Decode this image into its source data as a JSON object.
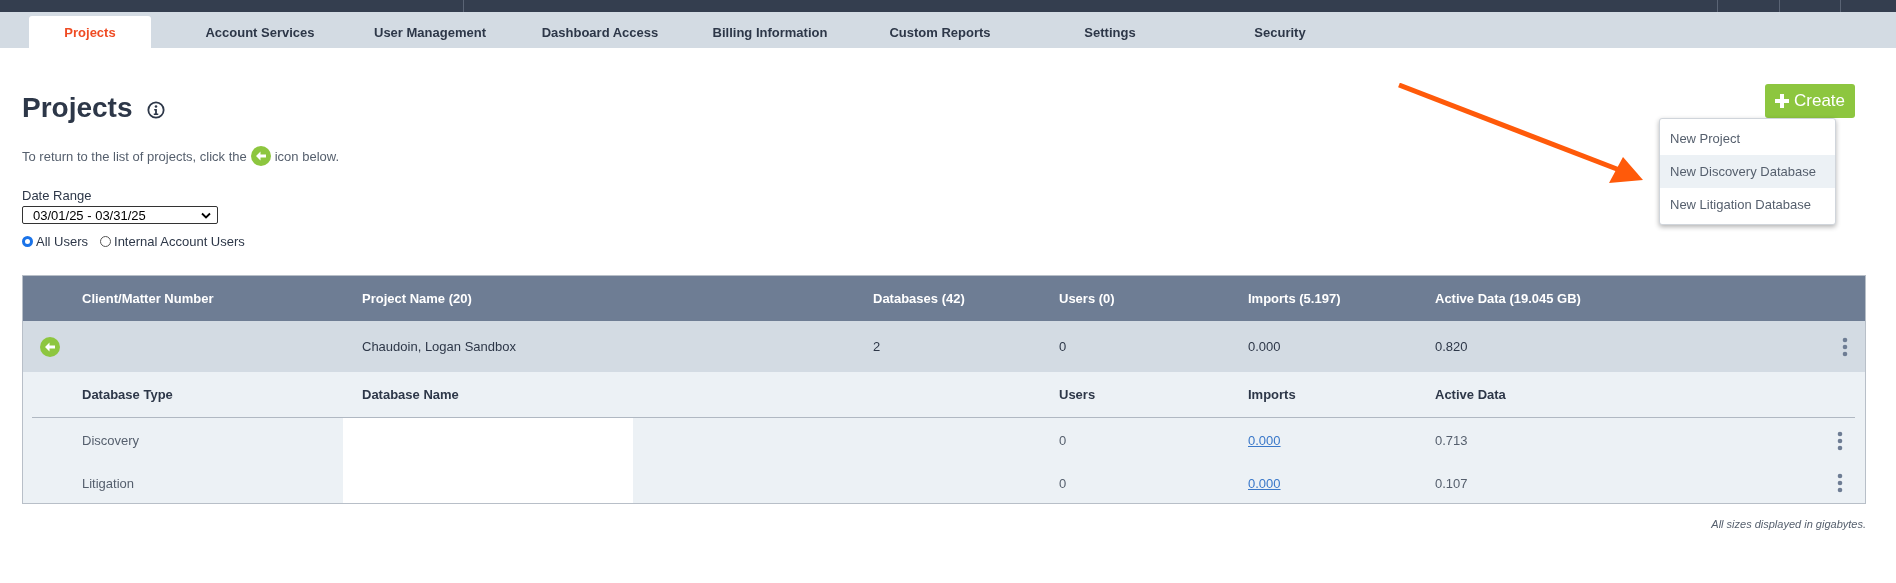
{
  "tabs": [
    {
      "label": "Projects",
      "selected": true
    },
    {
      "label": "Account Services",
      "selected": false
    },
    {
      "label": "User Management",
      "selected": false
    },
    {
      "label": "Dashboard Access",
      "selected": false
    },
    {
      "label": "Billing Information",
      "selected": false
    },
    {
      "label": "Custom Reports",
      "selected": false
    },
    {
      "label": "Settings",
      "selected": false
    },
    {
      "label": "Security",
      "selected": false
    }
  ],
  "title": "Projects",
  "instruction": {
    "before": "To return to the list of projects, click the",
    "after": "icon below."
  },
  "date_range": {
    "label": "Date Range",
    "value": "03/01/25 - 03/31/25"
  },
  "user_filter": [
    {
      "label": "All Users",
      "selected": true
    },
    {
      "label": "Internal Account Users",
      "selected": false
    }
  ],
  "create_button": {
    "label": "Create"
  },
  "create_menu": [
    {
      "label": "New Project",
      "highlighted": false
    },
    {
      "label": "New Discovery Database",
      "highlighted": true
    },
    {
      "label": "New Litigation Database",
      "highlighted": false
    }
  ],
  "table": {
    "columns": [
      "Client/Matter Number",
      "Project Name (20)",
      "Databases (42)",
      "Users (0)",
      "Imports (5.197)",
      "Active Data (19.045 GB)"
    ],
    "project": {
      "name": "Chaudoin, Logan Sandbox",
      "databases": "2",
      "users": "0",
      "imports": "0.000",
      "active_data": "0.820",
      "expanded": true
    },
    "sub_columns": [
      "Database Type",
      "Database Name",
      "Users",
      "Imports",
      "Active Data"
    ],
    "sub_rows": [
      {
        "type": "Discovery",
        "redacted": true,
        "users": "0",
        "imports": "0.000",
        "active_data": "0.713"
      },
      {
        "type": "Litigation",
        "redacted": true,
        "users": "0",
        "imports": "0.000",
        "active_data": "0.107"
      }
    ]
  },
  "footnote": "All sizes displayed in gigabytes."
}
